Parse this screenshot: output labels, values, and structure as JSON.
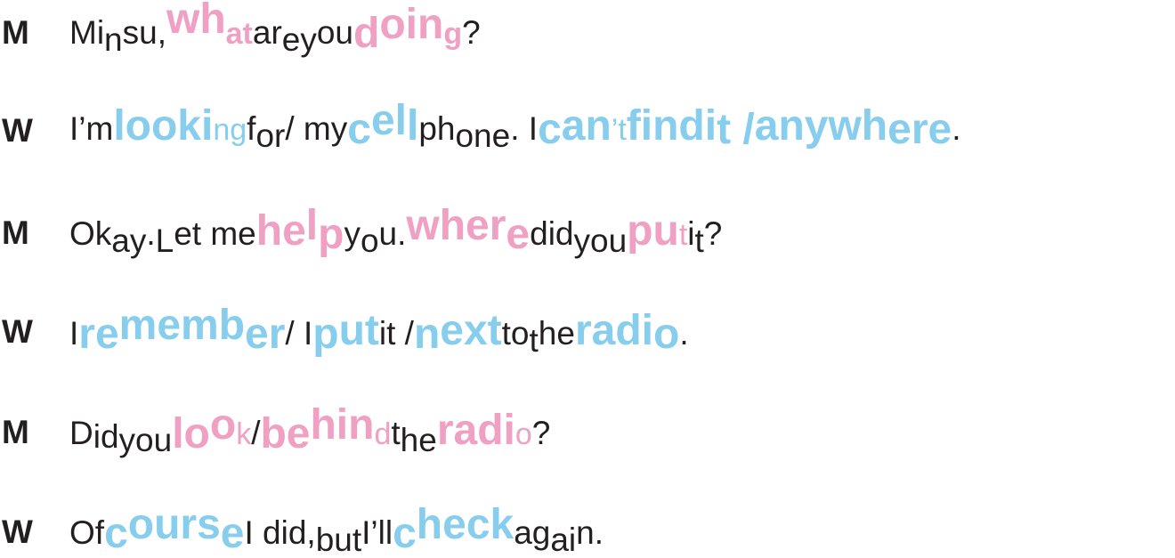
{
  "speakers": [
    "M",
    "W",
    "M",
    "W",
    "M",
    "W"
  ],
  "lines": [
    [
      {
        "t": "Mi"
      },
      {
        "t": "n",
        "cls": "down"
      },
      {
        "t": "su, "
      },
      {
        "t": "wh",
        "cls": "big pink up2"
      },
      {
        "t": "at",
        "cls": "big pink sm"
      },
      {
        "t": " ar"
      },
      {
        "t": "e",
        "cls": "down"
      },
      {
        "t": " "
      },
      {
        "t": "y",
        "cls": "down"
      },
      {
        "t": "ou "
      },
      {
        "t": "d",
        "cls": "big pink down2"
      },
      {
        "t": "oin",
        "cls": "big pink up"
      },
      {
        "t": "g",
        "cls": "big pink sm"
      },
      {
        "t": "?"
      }
    ],
    [
      {
        "t": "I’m "
      },
      {
        "t": "looki",
        "cls": "big blue"
      },
      {
        "t": "ng",
        "cls": "blue sm"
      },
      {
        "t": " f"
      },
      {
        "t": "or",
        "cls": "down"
      },
      {
        "t": " / my "
      },
      {
        "t": "c",
        "cls": "big blue down2"
      },
      {
        "t": "el",
        "cls": "big blue up"
      },
      {
        "t": "l",
        "cls": "big blue"
      },
      {
        "t": " ph"
      },
      {
        "t": "one",
        "cls": "down"
      },
      {
        "t": ". I "
      },
      {
        "t": "c",
        "cls": "big blue down2"
      },
      {
        "t": "an",
        "cls": "big blue"
      },
      {
        "t": "’t ",
        "cls": "blue sm"
      },
      {
        "t": "find ",
        "cls": "big blue"
      },
      {
        "t": "i",
        "cls": "big blue"
      },
      {
        "t": "t / ",
        "cls": "big blue down2"
      },
      {
        "t": "anywh",
        "cls": "big blue"
      },
      {
        "t": "ere",
        "cls": "big blue down2"
      },
      {
        "t": "."
      }
    ],
    [
      {
        "t": "Ok"
      },
      {
        "t": "ay",
        "cls": "down"
      },
      {
        "t": ". "
      },
      {
        "t": "L",
        "cls": "down"
      },
      {
        "t": "et me "
      },
      {
        "t": "he",
        "cls": "big pink"
      },
      {
        "t": "l",
        "cls": "big pink up"
      },
      {
        "t": "p",
        "cls": "big pink down2"
      },
      {
        "t": " y"
      },
      {
        "t": "o",
        "cls": "down"
      },
      {
        "t": "u. "
      },
      {
        "t": "wher",
        "cls": "big pink up"
      },
      {
        "t": "e",
        "cls": "big pink down2"
      },
      {
        "t": " did "
      },
      {
        "t": "you",
        "cls": "down"
      },
      {
        "t": " "
      },
      {
        "t": "pu",
        "cls": "big pink"
      },
      {
        "t": "t",
        "cls": "pink sm"
      },
      {
        "t": " i"
      },
      {
        "t": "t",
        "cls": "down"
      },
      {
        "t": "?"
      }
    ],
    [
      {
        "t": " I "
      },
      {
        "t": "re",
        "cls": "big blue down2"
      },
      {
        "t": "memb",
        "cls": "big blue up"
      },
      {
        "t": "er",
        "cls": "big blue down2"
      },
      {
        "t": " / I "
      },
      {
        "t": "p",
        "cls": "big blue down2"
      },
      {
        "t": "ut",
        "cls": "big blue"
      },
      {
        "t": " it / "
      },
      {
        "t": "n",
        "cls": "big blue down2"
      },
      {
        "t": "ext",
        "cls": "big blue"
      },
      {
        "t": " to "
      },
      {
        "t": "t",
        "cls": "down"
      },
      {
        "t": "he "
      },
      {
        "t": "radi",
        "cls": "big blue"
      },
      {
        "t": "o",
        "cls": "big blue down2"
      },
      {
        "t": "."
      }
    ],
    [
      {
        "t": "D"
      },
      {
        "t": "id",
        "cls": "down2"
      },
      {
        "t": " "
      },
      {
        "t": "you",
        "cls": "down"
      },
      {
        "t": " "
      },
      {
        "t": "lo",
        "cls": "big pink down2"
      },
      {
        "t": "o",
        "cls": "big pink up"
      },
      {
        "t": "k",
        "cls": "pink sm"
      },
      {
        "t": " / "
      },
      {
        "t": "be",
        "cls": "big pink down2"
      },
      {
        "t": "hin",
        "cls": "big pink up"
      },
      {
        "t": "d",
        "cls": "pink sm"
      },
      {
        "t": " t"
      },
      {
        "t": "he",
        "cls": "down"
      },
      {
        "t": " "
      },
      {
        "t": "radi",
        "cls": "big pink"
      },
      {
        "t": "o",
        "cls": "pink sm"
      },
      {
        "t": "?"
      }
    ],
    [
      {
        "t": "Of "
      },
      {
        "t": "c",
        "cls": "big blue down2"
      },
      {
        "t": "ours",
        "cls": "big blue up"
      },
      {
        "t": "e",
        "cls": "big blue down2"
      },
      {
        "t": " I did, "
      },
      {
        "t": "but",
        "cls": "down"
      },
      {
        "t": " I’ll "
      },
      {
        "t": "c",
        "cls": "big blue down2"
      },
      {
        "t": "heck",
        "cls": "big blue up"
      },
      {
        "t": " ag"
      },
      {
        "t": "ai",
        "cls": "down"
      },
      {
        "t": "n."
      }
    ]
  ]
}
